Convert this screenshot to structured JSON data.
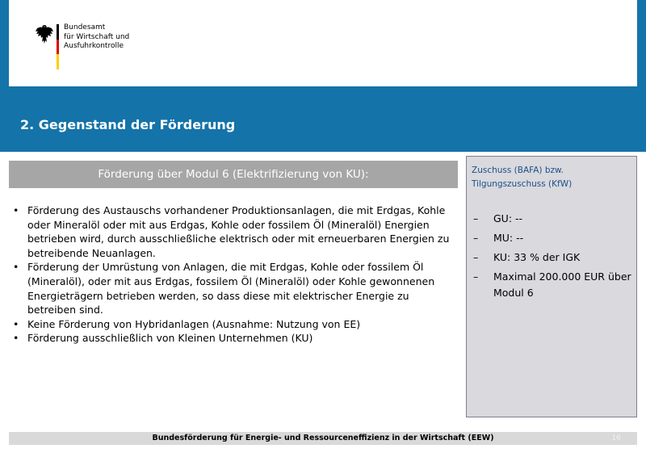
{
  "header": {
    "agency_name_lines": [
      "Bundesamt",
      "für Wirtschaft und",
      "Ausfuhrkontrolle"
    ],
    "title": "2. Gegenstand der Förderung"
  },
  "main": {
    "banner": "Förderung über Modul 6 (Elektrifizierung von KU):",
    "bullets": [
      "Förderung des  Austauschs vorhandener Produktionsanlagen, die mit Erdgas, Kohle oder Mineralöl oder mit aus Erdgas, Kohle oder fossilem Öl (Mineralöl) Energien betrieben wird, durch ausschließliche elektrisch oder mit erneuerbaren Energien zu betreibende Neuanlagen.",
      "Förderung der Umrüstung von Anlagen, die mit Erdgas, Kohle oder fossilem Öl (Mineralöl), oder mit aus Erdgas, fossilem Öl (Mineralöl) oder Kohle gewonnenen Energieträgern betrieben werden, so dass diese mit elektrischer Energie zu betreiben sind.",
      "Keine Förderung von Hybridanlagen (Ausnahme: Nutzung von EE)",
      "Förderung ausschließlich von Kleinen Unternehmen (KU)"
    ],
    "bullet_marker": "•"
  },
  "sidebar": {
    "title": "Zuschuss (BAFA) bzw. Tilgungszuschuss (KfW)",
    "dash_marker": "–",
    "items": [
      "GU: --",
      "MU: --",
      "KU:  33 % der IGK",
      "Maximal 200.000 EUR über Modul 6"
    ]
  },
  "footer": {
    "text": "Bundesförderung für Energie- und Ressourceneffizienz in der Wirtschaft (EEW)",
    "page_number": "16"
  },
  "colors": {
    "header_blue": "#1473a8",
    "banner_gray": "#a6a6a6",
    "sidebar_bg": "#d9d9de",
    "sidebar_title": "#1c4f8a",
    "flag_black": "#000000",
    "flag_red": "#dd0000",
    "flag_gold": "#ffce00"
  }
}
